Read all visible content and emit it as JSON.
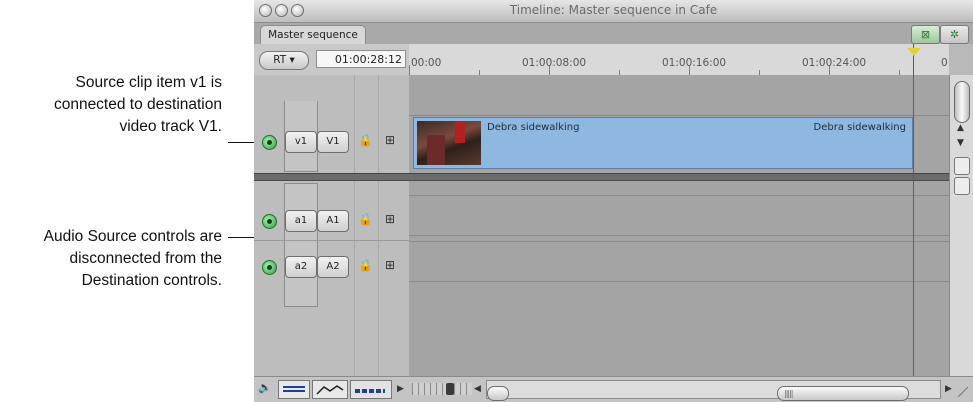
{
  "annotations": {
    "video": [
      "Source clip item v1 is",
      "connected to destination",
      "video track V1."
    ],
    "audio": [
      "Audio Source controls are",
      "disconnected from the",
      "Destination controls."
    ]
  },
  "window": {
    "title": "Timeline: Master sequence in Cafe",
    "tab": "Master sequence",
    "rt_button": "RT ▾",
    "timecode": "01:00:28:12"
  },
  "ruler": {
    "labels": [
      "00:00",
      "01:00:08:00",
      "01:00:16:00",
      "01:00:24:00",
      "0"
    ]
  },
  "tracks": {
    "video": {
      "source": "v1",
      "dest": "V1"
    },
    "audio1": {
      "source": "a1",
      "dest": "A1"
    },
    "audio2": {
      "source": "a2",
      "dest": "A2"
    }
  },
  "clip": {
    "name_left": "Debra sidewalking",
    "name_right": "Debra sidewalking"
  },
  "icons": {
    "lock": "🔒",
    "autoselect": "⊞",
    "speaker": "🔈",
    "arrow_left": "◀",
    "arrow_right": "▶",
    "arrow_up": "▲",
    "arrow_down": "▼"
  },
  "colors": {
    "clip_fill": "#8fb8e0",
    "source_active": "#2f9a44",
    "playhead_marker": "#e2d23a"
  }
}
